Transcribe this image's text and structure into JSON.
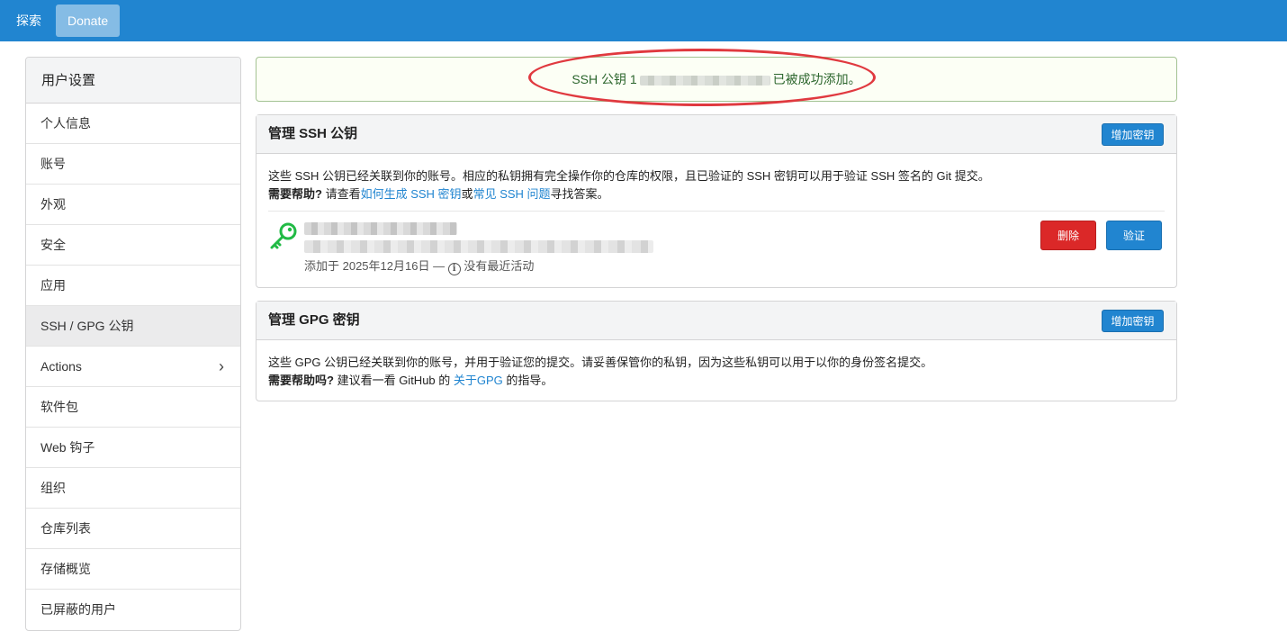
{
  "topbar": {
    "explore_label": "探索",
    "donate_label": "Donate",
    "bg_color": "#2185d0"
  },
  "sidebar": {
    "heading": "用户设置",
    "items": [
      {
        "label": "个人信息"
      },
      {
        "label": "账号"
      },
      {
        "label": "外观"
      },
      {
        "label": "安全"
      },
      {
        "label": "应用"
      },
      {
        "label": "SSH / GPG 公钥",
        "active": true
      },
      {
        "label": "Actions",
        "icon": "chevron-right-icon"
      },
      {
        "label": "软件包"
      },
      {
        "label": "Web 钩子"
      },
      {
        "label": "组织"
      },
      {
        "label": "仓库列表"
      },
      {
        "label": "存储概览"
      },
      {
        "label": "已屏蔽的用户"
      }
    ]
  },
  "flash": {
    "prefix": "SSH 公钥 1",
    "suffix": "已被成功添加。",
    "color": "#2c662d",
    "annotation_color": "#e0393f"
  },
  "ssh_panel": {
    "title": "管理 SSH 公钥",
    "add_button": "增加密钥",
    "desc_line1": "这些 SSH 公钥已经关联到你的账号。相应的私钥拥有完全操作你的仓库的权限，且已验证的 SSH 密钥可以用于验证 SSH 签名的 Git 提交。",
    "help_label": "需要帮助?",
    "help_pre": "请查看",
    "help_link1": "如何生成 SSH 密钥",
    "help_or": "或",
    "help_link2": "常见 SSH 问题",
    "help_post": "寻找答案。",
    "key": {
      "icon": "key-icon",
      "added": "添加于 2025年12月16日 —",
      "activity": "没有最近活动",
      "delete_label": "删除",
      "verify_label": "验证"
    }
  },
  "gpg_panel": {
    "title": "管理 GPG 密钥",
    "add_button": "增加密钥",
    "desc_line1": "这些 GPG 公钥已经关联到你的账号，并用于验证您的提交。请妥善保管你的私钥，因为这些私钥可以用于以你的身份签名提交。",
    "help_label": "需要帮助吗?",
    "help_pre": "建议看一看 GitHub 的",
    "help_link": "关于GPG",
    "help_post": "的指导。"
  }
}
